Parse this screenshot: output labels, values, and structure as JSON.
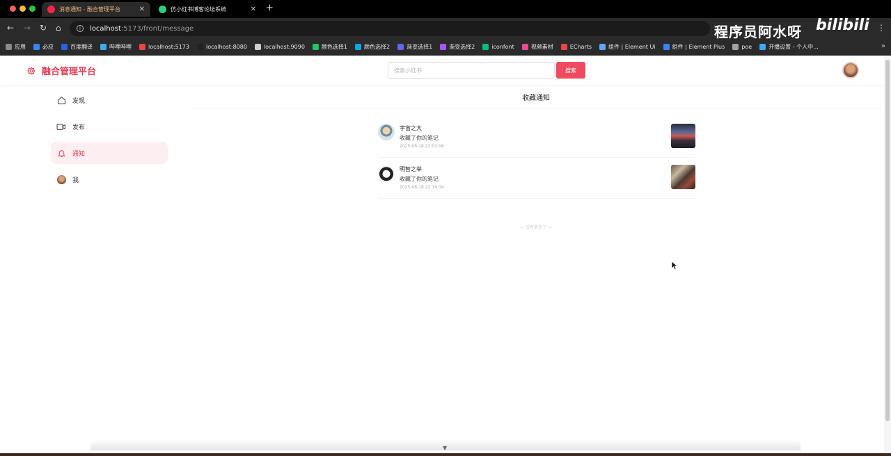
{
  "browser": {
    "tabs": [
      {
        "title": "消息通知 - 融合管理平台",
        "active": true
      },
      {
        "title": "仿小红书博客论坛系统",
        "active": false
      }
    ],
    "new_tab": "+",
    "close_glyph": "✕",
    "url_host": "localhost",
    "url_path": ":5173/front/message",
    "bookmarks": [
      {
        "label": "应用",
        "color": "#8a8a8a"
      },
      {
        "label": "必应",
        "color": "#3b82f6"
      },
      {
        "label": "百度翻译",
        "color": "#2563eb"
      },
      {
        "label": "哔哩哔哩",
        "color": "#3fa9f5"
      },
      {
        "label": "localhost:5173",
        "color": "#ef4444"
      },
      {
        "label": "localhost:8080",
        "color": "#222222"
      },
      {
        "label": "localhost:9090",
        "color": "#cfcfcf"
      },
      {
        "label": "颜色选择1",
        "color": "#22c55e"
      },
      {
        "label": "颜色选择2",
        "color": "#0ea5e9"
      },
      {
        "label": "渐变选择1",
        "color": "#6366f1"
      },
      {
        "label": "渐变选择2",
        "color": "#a855f7"
      },
      {
        "label": "iconfont",
        "color": "#10b981"
      },
      {
        "label": "视频素材",
        "color": "#ec4899"
      },
      {
        "label": "ECharts",
        "color": "#ef4444"
      },
      {
        "label": "组件 | Element Ui",
        "color": "#60a5fa"
      },
      {
        "label": "组件 | Element Plus",
        "color": "#3b82f6"
      },
      {
        "label": "poe",
        "color": "#9ca3af"
      },
      {
        "label": "开播设置 - 个人中...",
        "color": "#3fa9f5"
      }
    ],
    "bookmarks_more": "»",
    "watermark": "程序员阿水呀",
    "bili_logo": "bilibili"
  },
  "header": {
    "brand": "融合管理平台",
    "search_placeholder": "搜索小红书",
    "search_button": "搜索"
  },
  "sidebar": {
    "items": [
      {
        "label": "发现",
        "icon": "home-icon",
        "active": false
      },
      {
        "label": "发布",
        "icon": "video-icon",
        "active": false
      },
      {
        "label": "通知",
        "icon": "bell-icon",
        "active": true
      },
      {
        "label": "我",
        "icon": "avatar",
        "active": false
      }
    ]
  },
  "main": {
    "title": "收藏通知",
    "notices": [
      {
        "name": "宇宙之大",
        "action": "收藏了你的笔记",
        "time": "2025-08-18 22:02:06"
      },
      {
        "name": "明智之举",
        "action": "收藏了你的笔记",
        "time": "2025-08-18 22:19:34"
      }
    ],
    "end_tip": "— 没有更多了 —"
  },
  "colors": {
    "accent": "#e23c52",
    "search_button": "#ef4a5f",
    "active_bg": "#fdeff1"
  }
}
